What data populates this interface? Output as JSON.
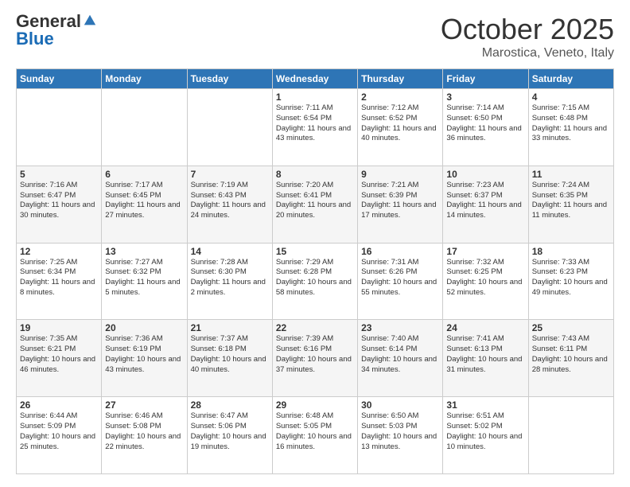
{
  "header": {
    "logo_general": "General",
    "logo_blue": "Blue",
    "month_title": "October 2025",
    "location": "Marostica, Veneto, Italy"
  },
  "days_of_week": [
    "Sunday",
    "Monday",
    "Tuesday",
    "Wednesday",
    "Thursday",
    "Friday",
    "Saturday"
  ],
  "weeks": [
    [
      {
        "day": "",
        "info": ""
      },
      {
        "day": "",
        "info": ""
      },
      {
        "day": "",
        "info": ""
      },
      {
        "day": "1",
        "info": "Sunrise: 7:11 AM\nSunset: 6:54 PM\nDaylight: 11 hours and 43 minutes."
      },
      {
        "day": "2",
        "info": "Sunrise: 7:12 AM\nSunset: 6:52 PM\nDaylight: 11 hours and 40 minutes."
      },
      {
        "day": "3",
        "info": "Sunrise: 7:14 AM\nSunset: 6:50 PM\nDaylight: 11 hours and 36 minutes."
      },
      {
        "day": "4",
        "info": "Sunrise: 7:15 AM\nSunset: 6:48 PM\nDaylight: 11 hours and 33 minutes."
      }
    ],
    [
      {
        "day": "5",
        "info": "Sunrise: 7:16 AM\nSunset: 6:47 PM\nDaylight: 11 hours and 30 minutes."
      },
      {
        "day": "6",
        "info": "Sunrise: 7:17 AM\nSunset: 6:45 PM\nDaylight: 11 hours and 27 minutes."
      },
      {
        "day": "7",
        "info": "Sunrise: 7:19 AM\nSunset: 6:43 PM\nDaylight: 11 hours and 24 minutes."
      },
      {
        "day": "8",
        "info": "Sunrise: 7:20 AM\nSunset: 6:41 PM\nDaylight: 11 hours and 20 minutes."
      },
      {
        "day": "9",
        "info": "Sunrise: 7:21 AM\nSunset: 6:39 PM\nDaylight: 11 hours and 17 minutes."
      },
      {
        "day": "10",
        "info": "Sunrise: 7:23 AM\nSunset: 6:37 PM\nDaylight: 11 hours and 14 minutes."
      },
      {
        "day": "11",
        "info": "Sunrise: 7:24 AM\nSunset: 6:35 PM\nDaylight: 11 hours and 11 minutes."
      }
    ],
    [
      {
        "day": "12",
        "info": "Sunrise: 7:25 AM\nSunset: 6:34 PM\nDaylight: 11 hours and 8 minutes."
      },
      {
        "day": "13",
        "info": "Sunrise: 7:27 AM\nSunset: 6:32 PM\nDaylight: 11 hours and 5 minutes."
      },
      {
        "day": "14",
        "info": "Sunrise: 7:28 AM\nSunset: 6:30 PM\nDaylight: 11 hours and 2 minutes."
      },
      {
        "day": "15",
        "info": "Sunrise: 7:29 AM\nSunset: 6:28 PM\nDaylight: 10 hours and 58 minutes."
      },
      {
        "day": "16",
        "info": "Sunrise: 7:31 AM\nSunset: 6:26 PM\nDaylight: 10 hours and 55 minutes."
      },
      {
        "day": "17",
        "info": "Sunrise: 7:32 AM\nSunset: 6:25 PM\nDaylight: 10 hours and 52 minutes."
      },
      {
        "day": "18",
        "info": "Sunrise: 7:33 AM\nSunset: 6:23 PM\nDaylight: 10 hours and 49 minutes."
      }
    ],
    [
      {
        "day": "19",
        "info": "Sunrise: 7:35 AM\nSunset: 6:21 PM\nDaylight: 10 hours and 46 minutes."
      },
      {
        "day": "20",
        "info": "Sunrise: 7:36 AM\nSunset: 6:19 PM\nDaylight: 10 hours and 43 minutes."
      },
      {
        "day": "21",
        "info": "Sunrise: 7:37 AM\nSunset: 6:18 PM\nDaylight: 10 hours and 40 minutes."
      },
      {
        "day": "22",
        "info": "Sunrise: 7:39 AM\nSunset: 6:16 PM\nDaylight: 10 hours and 37 minutes."
      },
      {
        "day": "23",
        "info": "Sunrise: 7:40 AM\nSunset: 6:14 PM\nDaylight: 10 hours and 34 minutes."
      },
      {
        "day": "24",
        "info": "Sunrise: 7:41 AM\nSunset: 6:13 PM\nDaylight: 10 hours and 31 minutes."
      },
      {
        "day": "25",
        "info": "Sunrise: 7:43 AM\nSunset: 6:11 PM\nDaylight: 10 hours and 28 minutes."
      }
    ],
    [
      {
        "day": "26",
        "info": "Sunrise: 6:44 AM\nSunset: 5:09 PM\nDaylight: 10 hours and 25 minutes."
      },
      {
        "day": "27",
        "info": "Sunrise: 6:46 AM\nSunset: 5:08 PM\nDaylight: 10 hours and 22 minutes."
      },
      {
        "day": "28",
        "info": "Sunrise: 6:47 AM\nSunset: 5:06 PM\nDaylight: 10 hours and 19 minutes."
      },
      {
        "day": "29",
        "info": "Sunrise: 6:48 AM\nSunset: 5:05 PM\nDaylight: 10 hours and 16 minutes."
      },
      {
        "day": "30",
        "info": "Sunrise: 6:50 AM\nSunset: 5:03 PM\nDaylight: 10 hours and 13 minutes."
      },
      {
        "day": "31",
        "info": "Sunrise: 6:51 AM\nSunset: 5:02 PM\nDaylight: 10 hours and 10 minutes."
      },
      {
        "day": "",
        "info": ""
      }
    ]
  ]
}
